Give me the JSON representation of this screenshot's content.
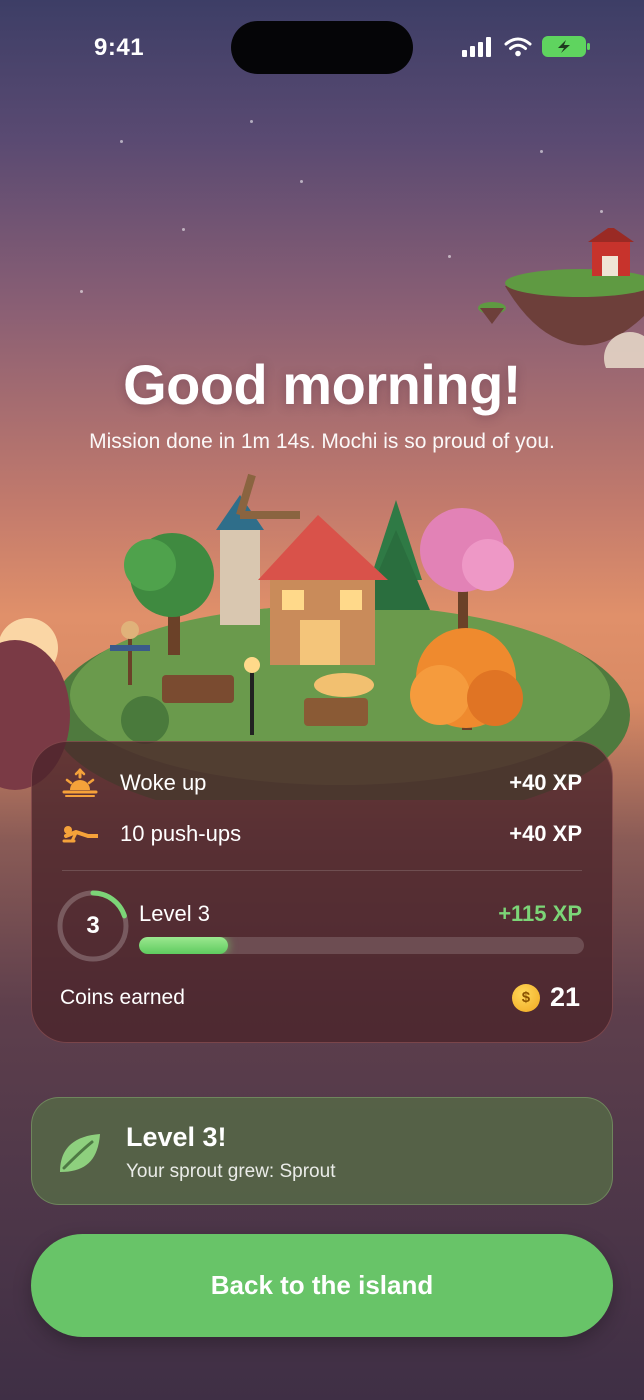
{
  "status_bar": {
    "time": "9:41"
  },
  "header": {
    "title": "Good morning!",
    "subtitle": "Mission done in 1m 14s. Mochi is so proud of you."
  },
  "summary": {
    "items": [
      {
        "icon": "sunrise-icon",
        "label": "Woke up",
        "xp": "+40 XP"
      },
      {
        "icon": "push-up-icon",
        "label": "10 push-ups",
        "xp": "+40 XP"
      }
    ],
    "level": {
      "number": "3",
      "title": "Level 3",
      "gained_xp": "+115 XP",
      "progress": 0.2
    },
    "coins": {
      "label": "Coins earned",
      "symbol": "$",
      "value": "21"
    }
  },
  "level_up": {
    "icon": "leaf-icon",
    "title": "Level 3!",
    "subtitle": "Your sprout grew: Sprout"
  },
  "cta": {
    "label": "Back to the island"
  },
  "colors": {
    "accent_green": "#68c468",
    "xp_green": "#7cd577",
    "card_bg": "#4a242a",
    "banner_bg": "#566846",
    "icon_orange": "#f5a23a"
  }
}
